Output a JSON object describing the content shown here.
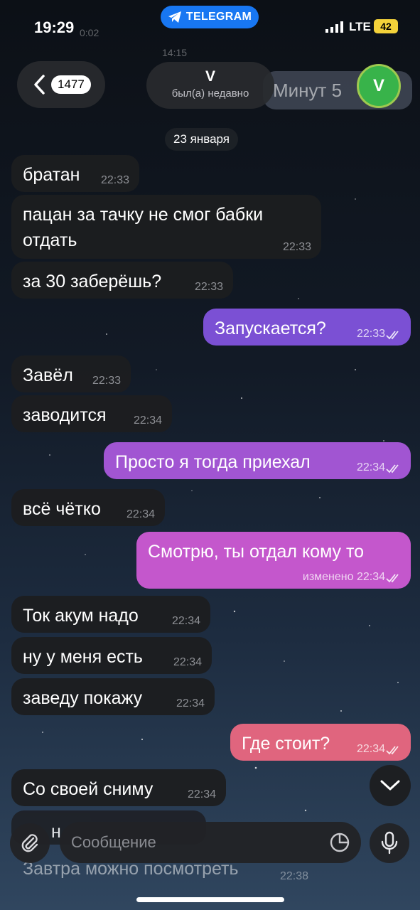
{
  "status_bar": {
    "time": "19:29",
    "pill": "TELEGRAM",
    "network": "LTE",
    "battery": "42",
    "faint_top": "0:02",
    "faint_time": "14:15"
  },
  "header": {
    "back_count": "1477",
    "name": "V",
    "status": "был(а) недавно",
    "avatar_letter": "V",
    "ghost_text": "Минут 5"
  },
  "date_chip": "23 января",
  "messages": [
    {
      "text": "братан",
      "time": "22:33",
      "dir": "in"
    },
    {
      "text": "пацан за тачку не смог бабки\nотдать",
      "time": "22:33",
      "dir": "in"
    },
    {
      "text": "за 30 заберёшь?",
      "time": "22:33",
      "dir": "in"
    },
    {
      "text": "Запускается?",
      "time": "22:33",
      "dir": "out"
    },
    {
      "text": "Завёл",
      "time": "22:33",
      "dir": "in"
    },
    {
      "text": "заводится",
      "time": "22:34",
      "dir": "in"
    },
    {
      "text": "Просто я тогда приехал",
      "time": "22:34",
      "dir": "out"
    },
    {
      "text": "всё чётко",
      "time": "22:34",
      "dir": "in"
    },
    {
      "text": "Смотрю, ты отдал кому то",
      "time": "изменено 22:34",
      "dir": "out"
    },
    {
      "text": "Ток акум надо",
      "time": "22:34",
      "dir": "in"
    },
    {
      "text": "ну у меня есть",
      "time": "22:34",
      "dir": "in"
    },
    {
      "text": "заведу покажу",
      "time": "22:34",
      "dir": "in"
    },
    {
      "text": "Где стоит?",
      "time": "22:34",
      "dir": "out"
    },
    {
      "text": "Со своей сниму",
      "time": "22:34",
      "dir": "in"
    }
  ],
  "behind_input": {
    "text": "Завтра можно посмотреть",
    "time": "22:38",
    "partial": "н"
  },
  "input": {
    "placeholder": "Сообщение"
  },
  "colors": {
    "out_purple": "#7b50d4",
    "out_magenta": "#c457cc",
    "out_pink": "#e0657e",
    "accent_blue": "#1877f2"
  }
}
